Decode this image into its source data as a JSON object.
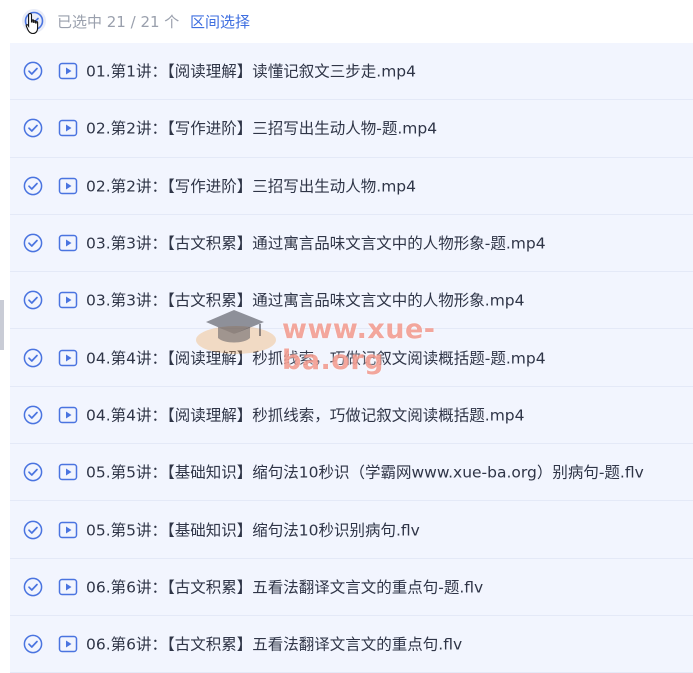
{
  "header": {
    "selection_count": "已选中 21 / 21 个",
    "range_select_label": "区间选择",
    "select_all_icon": "check-circle-icon",
    "cursor_icon": "hand-pointer-icon"
  },
  "files": [
    {
      "name": "01.第1讲：【阅读理解】读懂记叙文三步走.mp4"
    },
    {
      "name": "02.第2讲：【写作进阶】三招写出生动人物-题.mp4"
    },
    {
      "name": "02.第2讲：【写作进阶】三招写出生动人物.mp4"
    },
    {
      "name": "03.第3讲：【古文积累】通过寓言品味文言文中的人物形象-题.mp4"
    },
    {
      "name": "03.第3讲：【古文积累】通过寓言品味文言文中的人物形象.mp4"
    },
    {
      "name": "04.第4讲：【阅读理解】秒抓线索，巧做记叙文阅读概括题-题.mp4"
    },
    {
      "name": "04.第4讲：【阅读理解】秒抓线索，巧做记叙文阅读概括题.mp4"
    },
    {
      "name": "05.第5讲：【基础知识】缩句法10秒识（学霸网www.xue-ba.org）别病句-题.flv"
    },
    {
      "name": "05.第5讲：【基础知识】缩句法10秒识别病句.flv"
    },
    {
      "name": "06.第6讲：【古文积累】五看法翻译文言文的重点句-题.flv"
    },
    {
      "name": "06.第6讲：【古文积累】五看法翻译文言文的重点句.flv"
    }
  ],
  "watermark": {
    "text": "www.xue-ba.org",
    "icon": "graduation-cap-icon"
  },
  "colors": {
    "accent": "#3f6fe0",
    "row_bg": "#f2f5fe",
    "check": "#4a74e0",
    "watermark": "#eb5f4b"
  }
}
